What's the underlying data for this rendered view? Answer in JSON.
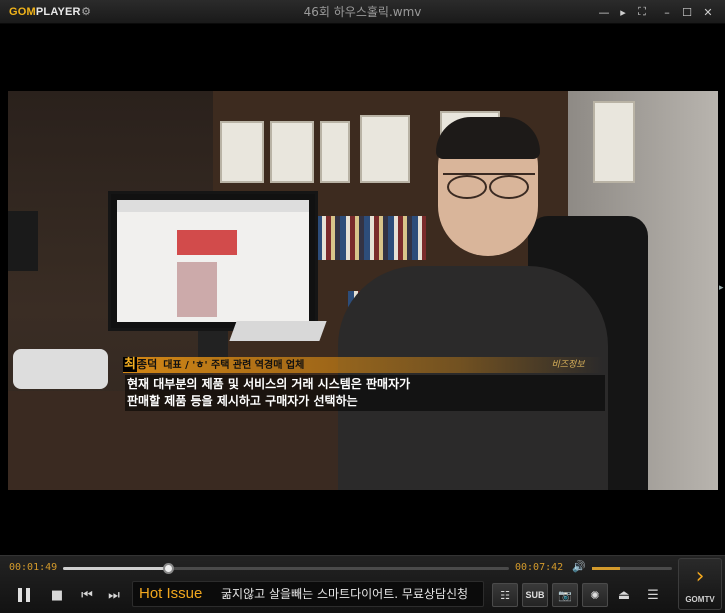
{
  "app": {
    "logo_part1": "GOM",
    "logo_part2": "PLAYER",
    "title": "46회 하우스홀릭.wmv"
  },
  "window_buttons": [
    {
      "name": "compact-mode-icon",
      "glyph": "—"
    },
    {
      "name": "play-mini-icon",
      "glyph": "▸"
    },
    {
      "name": "fullscreen-icon",
      "glyph": "⛶"
    },
    {
      "name": "minimize-icon",
      "glyph": "–"
    },
    {
      "name": "maximize-icon",
      "glyph": "☐"
    },
    {
      "name": "close-icon",
      "glyph": "✕"
    }
  ],
  "video": {
    "caption_surname": "최",
    "caption_given_name": "종덕",
    "caption_title": "대표 / 'ㅎ' 주택 관련 역경매 업체",
    "subtitle_line1": "현재 대부분의 제품 및 서비스의 거래 시스템은 판매자가",
    "subtitle_line2": "판매할 제품 등을 제시하고 구매자가 선택하는",
    "station_logo": "비즈정보"
  },
  "playback": {
    "elapsed": "00:01:49",
    "total": "00:07:42",
    "progress_fraction": 0.236,
    "volume_fraction": 0.35
  },
  "ticker": {
    "badge": "Hot Issue",
    "text": "굶지않고 살을빼는 스마트다이어트. 무료상담신청"
  },
  "toolbar": {
    "sub_label": "SUB",
    "gomtv_label": "GOMTV"
  },
  "colors": {
    "accent": "#f2a71e",
    "time_text": "#d39a2c"
  }
}
